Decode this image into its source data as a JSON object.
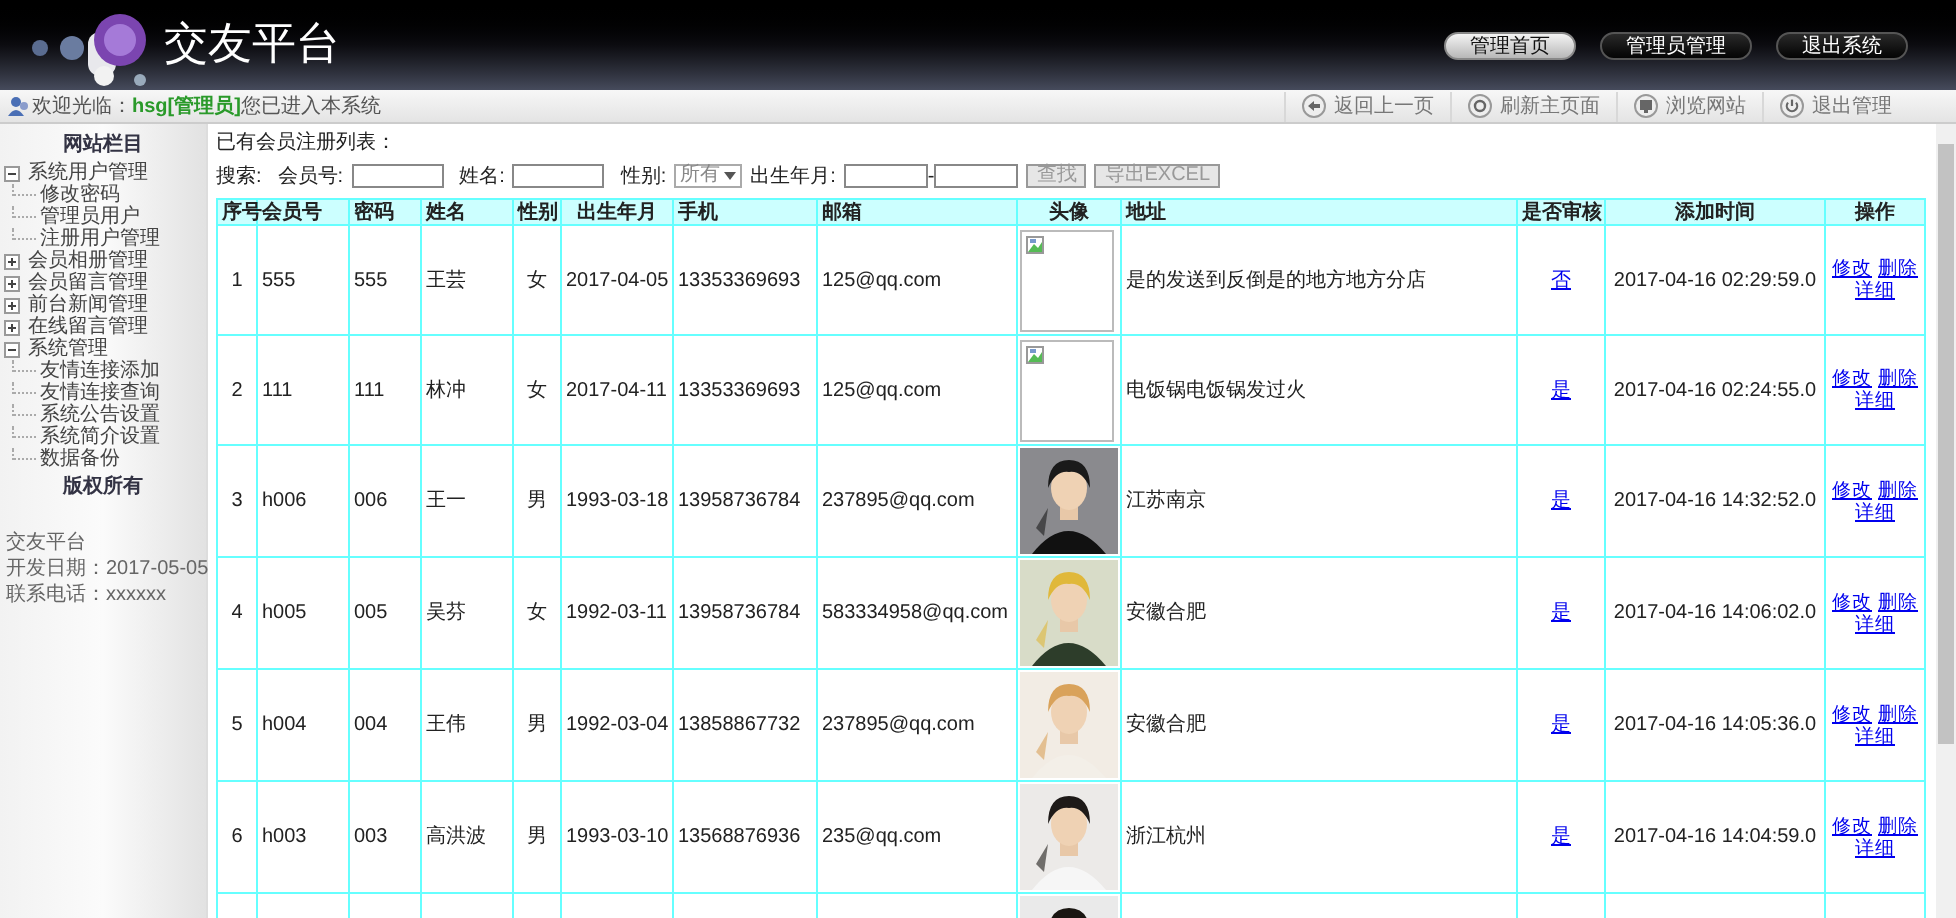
{
  "header": {
    "title": "交友平台",
    "nav": [
      {
        "label": "管理首页",
        "selected": true
      },
      {
        "label": "管理员管理",
        "selected": false
      },
      {
        "label": "退出系统",
        "selected": false
      }
    ]
  },
  "toolbar": {
    "welcome": "欢迎光临：",
    "user": "hsg[管理员]",
    "message": "您已进入本系统",
    "actions": [
      {
        "label": "返回上一页",
        "kind": "back"
      },
      {
        "label": "刷新主页面",
        "kind": "refresh"
      },
      {
        "label": "浏览网站",
        "kind": "monitor"
      },
      {
        "label": "退出管理",
        "kind": "power"
      }
    ]
  },
  "sidebar": {
    "heading": "网站栏目",
    "tree": [
      {
        "label": "系统用户管理",
        "expanded": true,
        "children": [
          {
            "label": "修改密码"
          },
          {
            "label": "管理员用户"
          },
          {
            "label": "注册用户管理"
          }
        ]
      },
      {
        "label": "会员相册管理",
        "expanded": false
      },
      {
        "label": "会员留言管理",
        "expanded": false
      },
      {
        "label": "前台新闻管理",
        "expanded": false
      },
      {
        "label": "在线留言管理",
        "expanded": false
      },
      {
        "label": "系统管理",
        "expanded": true,
        "children": [
          {
            "label": "友情连接添加"
          },
          {
            "label": "友情连接查询"
          },
          {
            "label": "系统公告设置"
          },
          {
            "label": "系统简介设置"
          },
          {
            "label": "数据备份"
          }
        ]
      }
    ],
    "copyright": "版权所有",
    "info": [
      "交友平台",
      "开发日期：2017-05-05",
      "联系电话：xxxxxx"
    ]
  },
  "main": {
    "caption": "已有会员注册列表：",
    "search": {
      "label": "搜索:",
      "fields": [
        {
          "label": "会员号:"
        },
        {
          "label": "姓名:"
        }
      ],
      "gender": {
        "label": "性别:",
        "value": "所有"
      },
      "birth_label": "出生年月:",
      "range_separator": "-",
      "buttons": [
        "查找",
        "导出EXCEL"
      ]
    },
    "table": {
      "columns": [
        "序号",
        "会员号",
        "密码",
        "姓名",
        "性别",
        "出生年月",
        "手机",
        "邮箱",
        "头像",
        "地址",
        "是否审核",
        "添加时间",
        "操作"
      ],
      "rows": [
        {
          "no": "1",
          "member_id": "555",
          "password": "555",
          "name": "王芸",
          "gender": "女",
          "birth": "2017-04-05",
          "phone": "13353369693",
          "email": "125@qq.com",
          "avatar": {
            "kind": "broken"
          },
          "address": "是的发送到反倒是的地方地方分店",
          "audited": "否",
          "added": "2017-04-16 02:29:59.0",
          "actions": [
            "修改",
            "删除",
            "详细"
          ]
        },
        {
          "no": "2",
          "member_id": "111",
          "password": "111",
          "name": "林冲",
          "gender": "女",
          "birth": "2017-04-11",
          "phone": "13353369693",
          "email": "125@qq.com",
          "avatar": {
            "kind": "broken"
          },
          "address": "电饭锅电饭锅发过火",
          "audited": "是",
          "added": "2017-04-16 02:24:55.0",
          "actions": [
            "修改",
            "删除",
            "详细"
          ]
        },
        {
          "no": "3",
          "member_id": "h006",
          "password": "006",
          "name": "王一",
          "gender": "男",
          "birth": "1993-03-18",
          "phone": "13958736784",
          "email": "237895@qq.com",
          "avatar": {
            "kind": "picture"
          },
          "address": "江苏南京",
          "audited": "是",
          "added": "2017-04-16 14:32:52.0",
          "actions": [
            "修改",
            "删除",
            "详细"
          ]
        },
        {
          "no": "4",
          "member_id": "h005",
          "password": "005",
          "name": "吴芬",
          "gender": "女",
          "birth": "1992-03-11",
          "phone": "13958736784",
          "email": "583334958@qq.com",
          "avatar": {
            "kind": "picture"
          },
          "address": "安徽合肥",
          "audited": "是",
          "added": "2017-04-16 14:06:02.0",
          "actions": [
            "修改",
            "删除",
            "详细"
          ]
        },
        {
          "no": "5",
          "member_id": "h004",
          "password": "004",
          "name": "王伟",
          "gender": "男",
          "birth": "1992-03-04",
          "phone": "13858867732",
          "email": "237895@qq.com",
          "avatar": {
            "kind": "picture"
          },
          "address": "安徽合肥",
          "audited": "是",
          "added": "2017-04-16 14:05:36.0",
          "actions": [
            "修改",
            "删除",
            "详细"
          ]
        },
        {
          "no": "6",
          "member_id": "h003",
          "password": "003",
          "name": "高洪波",
          "gender": "男",
          "birth": "1993-03-10",
          "phone": "13568876936",
          "email": "235@qq.com",
          "avatar": {
            "kind": "picture"
          },
          "address": "浙江杭州",
          "audited": "是",
          "added": "2017-04-16 14:04:59.0",
          "actions": [
            "修改",
            "删除",
            "详细"
          ]
        }
      ],
      "cut_off_row": {
        "avatar": {
          "kind": "picture"
        }
      }
    }
  }
}
